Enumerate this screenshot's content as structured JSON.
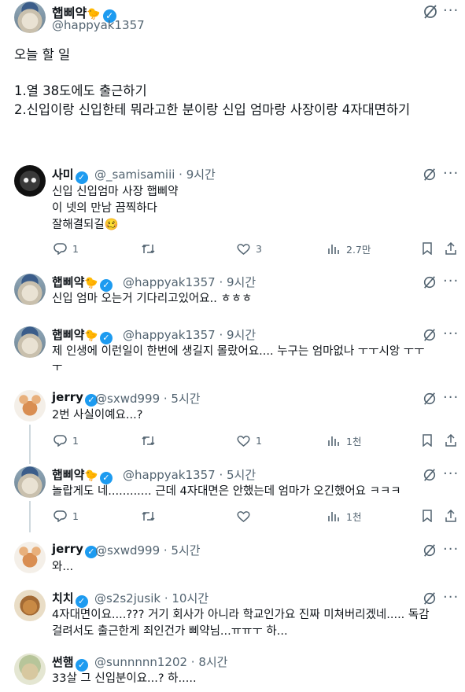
{
  "main_tweet": {
    "name": "햅삐약",
    "emoji": "🐤",
    "handle": "@happyak1357",
    "title_line": "오늘 할 일",
    "line1": "1.열 38도에도 출근하기",
    "line2": "2.신입이랑 신입한테 뭐라고한 분이랑 신입 엄마랑 사장이랑 4자대면하기"
  },
  "replies": [
    {
      "name": "사미",
      "handle": "@_samisamiii · 9시간",
      "lines": [
        "신입 신입엄마 사장 햅삐약",
        "이 넷의 만남 끔찍하다",
        "잘해결되길🥴"
      ],
      "actions": {
        "reply": "1",
        "retweet": "",
        "like": "3",
        "views": "2.7만"
      }
    },
    {
      "name": "햅삐약",
      "emoji": "🐤",
      "handle": "@happyak1357 · 9시간",
      "lines": [
        "신입 엄마 오는거 기다리고있어요.. ㅎㅎㅎ"
      ]
    },
    {
      "name": "햅삐약",
      "emoji": "🐤",
      "handle": "@happyak1357 · 9시간",
      "lines": [
        "제 인생에 이런일이 한번에 생길지 몰랐어요.... 누구는 엄마없나 ㅜㅜ시앙 ㅜㅜ",
        "ㅜ"
      ]
    },
    {
      "name": "jerry",
      "handle": "@sxwd999 · 5시간",
      "lines": [
        "2번 사실이예요...?"
      ],
      "actions": {
        "reply": "1",
        "retweet": "",
        "like": "1",
        "views": "1천"
      }
    },
    {
      "name": "햅삐약",
      "emoji": "🐤",
      "handle": "@happyak1357 · 5시간",
      "lines": [
        "놀랍게도 네............ 근데 4자대면은 안했는데 엄마가 오긴했어요 ㅋㅋㅋ"
      ],
      "actions": {
        "reply": "1",
        "retweet": "",
        "like": "",
        "views": "1천"
      }
    },
    {
      "name": "jerry",
      "handle": "@sxwd999 · 5시간",
      "lines": [
        "와..."
      ]
    },
    {
      "name": "치치",
      "handle": "@s2s2jusik · 10시간",
      "lines": [
        "4자대면이요....??? 거기 회사가 아니라 학교인가요 진짜 미쳐버리겠네..... 독감",
        "걸려서도 출근한게 죄인건가 삐약님...ㅠㅠㅜ 하..."
      ]
    },
    {
      "name": "썬햄",
      "handle": "@sunnnnn1202 · 8시간",
      "lines": [
        "33살 그 신입분이요...? 하....."
      ]
    }
  ],
  "icons": {
    "verified": "verified-badge-icon",
    "grok": "grok-icon",
    "more": "more-icon",
    "reply": "reply-icon",
    "retweet": "retweet-icon",
    "like": "like-icon",
    "views": "views-icon",
    "bookmark": "bookmark-icon",
    "share": "share-icon"
  },
  "colors": {
    "verified": "#1d9bf0",
    "secondary_text": "#536471",
    "primary_text": "#0f1419"
  }
}
